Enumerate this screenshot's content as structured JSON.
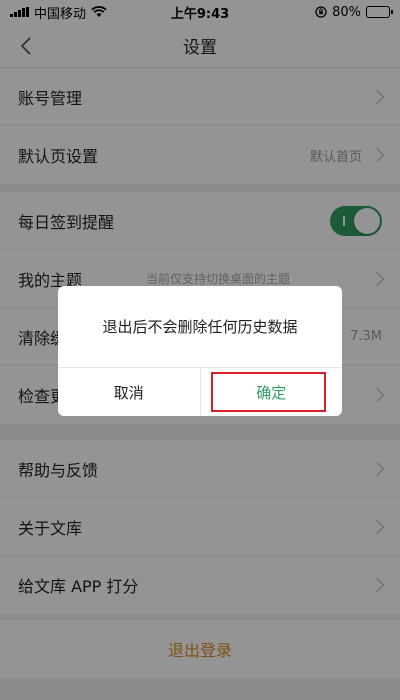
{
  "status_bar": {
    "carrier": "中国移动",
    "time": "上午9:43",
    "battery_text": "80%",
    "battery_level": 0.8
  },
  "header": {
    "title": "设置"
  },
  "settings": {
    "group1": [
      {
        "label": "账号管理",
        "value": ""
      },
      {
        "label": "默认页设置",
        "value": "默认首页"
      }
    ],
    "group2": [
      {
        "label": "每日签到提醒",
        "toggle": true
      },
      {
        "label": "我的主题",
        "hint": "当前仅支持切换桌面的主题"
      },
      {
        "label": "清除缓存",
        "visible_label": "清除缓",
        "value": "7.3M"
      },
      {
        "label": "检查更新",
        "visible_label": "检查更"
      }
    ],
    "group3": [
      {
        "label": "帮助与反馈"
      },
      {
        "label": "关于文库"
      },
      {
        "label": "给文库 APP 打分"
      }
    ]
  },
  "logout_label": "退出登录",
  "dialog": {
    "message": "退出后不会删除任何历史数据",
    "cancel_label": "取消",
    "confirm_label": "确定"
  },
  "colors": {
    "accent_green": "#2f9e62",
    "logout_orange": "#d98d1f",
    "highlight_red": "#d61f2a"
  }
}
